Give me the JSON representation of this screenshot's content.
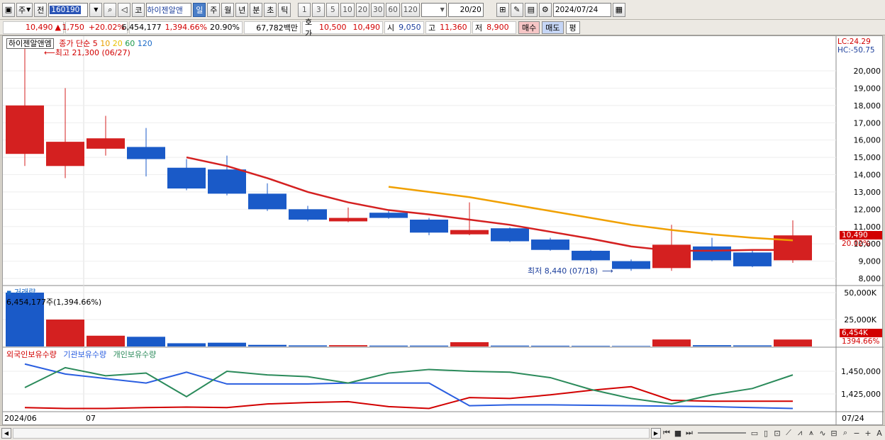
{
  "toolbar": {
    "market": "주",
    "prev_label": "전",
    "code": "160190",
    "market_short": "코",
    "name": "하이젠알앤",
    "periods": [
      "일",
      "주",
      "월",
      "년",
      "분",
      "초",
      "틱"
    ],
    "selected_period": "일",
    "intervals": [
      "1",
      "3",
      "5",
      "10",
      "20",
      "30",
      "60",
      "120"
    ],
    "count": "20/20",
    "date": "2024/07/24"
  },
  "quote": {
    "price": "10,490",
    "change": "1,750",
    "change_pct": "+20.02%",
    "volume": "6,454,177",
    "volume_ratio": "1,394.66%",
    "turnover": "20.90%",
    "value": "67,782백만",
    "ask_label": "호가",
    "ask": "10,500",
    "bid": "10,490",
    "open_label": "시",
    "open": "9,050",
    "high_label": "고",
    "high": "11,360",
    "low_label": "저",
    "low": "8,900",
    "buy_label": "매수",
    "sell_label": "매도",
    "avg_label": "평"
  },
  "price_panel": {
    "stock_label": "하이젠알앤엠",
    "legend_title": "종가 단순",
    "ma_labels": [
      "5",
      "10",
      "20",
      "60",
      "120"
    ],
    "ma_colors": [
      "#d20000",
      "#e8a000",
      "#e8c000",
      "#1a9a4a",
      "#1a6ac8"
    ],
    "max_annotation": "최고 21,300 (06/27)",
    "min_annotation": "최저 8,440 (07/18)",
    "lc": "LC:24.29",
    "hc": "HC:-50.75",
    "price_tag": "10,490",
    "pct_tag": "20.02%"
  },
  "volume_panel": {
    "title": "거래량",
    "readout": "6,454,177주(1,394.66%)",
    "tag": "6,454K",
    "pct_tag": "1394.66%"
  },
  "holding_panel": {
    "series_labels": [
      "외국인보유수량",
      "기관보유수량",
      "개인보유수량"
    ],
    "series_colors": [
      "#d20000",
      "#2a5ee0",
      "#2a8a5a"
    ]
  },
  "x_labels": {
    "start": "2024/06",
    "month": "07",
    "end": "07/24"
  },
  "chart_data": [
    {
      "type": "candlestick",
      "title": "",
      "y_ticks": [
        8000,
        9000,
        10000,
        11000,
        12000,
        13000,
        14000,
        15000,
        16000,
        17000,
        18000,
        19000,
        20000
      ],
      "candles": [
        {
          "open": 15200,
          "high": 21300,
          "low": 14500,
          "close": 18000
        },
        {
          "open": 14500,
          "high": 19000,
          "low": 13800,
          "close": 15900
        },
        {
          "open": 15500,
          "high": 17400,
          "low": 15100,
          "close": 16100
        },
        {
          "open": 15600,
          "high": 16700,
          "low": 13900,
          "close": 14900
        },
        {
          "open": 14400,
          "high": 14900,
          "low": 13100,
          "close": 13200
        },
        {
          "open": 14300,
          "high": 15100,
          "low": 12800,
          "close": 12900
        },
        {
          "open": 12900,
          "high": 13500,
          "low": 11900,
          "close": 12000
        },
        {
          "open": 12000,
          "high": 12200,
          "low": 11300,
          "close": 11400
        },
        {
          "open": 11300,
          "high": 12100,
          "low": 11250,
          "close": 11500
        },
        {
          "open": 11800,
          "high": 11900,
          "low": 11450,
          "close": 11500
        },
        {
          "open": 11400,
          "high": 11500,
          "low": 10500,
          "close": 10650
        },
        {
          "open": 10550,
          "high": 12400,
          "low": 10500,
          "close": 10800
        },
        {
          "open": 10900,
          "high": 10950,
          "low": 10100,
          "close": 10150
        },
        {
          "open": 10250,
          "high": 10350,
          "low": 9600,
          "close": 9650
        },
        {
          "open": 9600,
          "high": 9650,
          "low": 9000,
          "close": 9050
        },
        {
          "open": 9000,
          "high": 9100,
          "low": 8440,
          "close": 8550
        },
        {
          "open": 8600,
          "high": 11100,
          "low": 8440,
          "close": 9950
        },
        {
          "open": 9850,
          "high": 10350,
          "low": 9000,
          "close": 9050
        },
        {
          "open": 9500,
          "high": 9650,
          "low": 8650,
          "close": 8700
        },
        {
          "open": 9050,
          "high": 11360,
          "low": 8900,
          "close": 10490
        }
      ],
      "ma5": [
        null,
        null,
        null,
        null,
        15000,
        14500,
        13800,
        13000,
        12400,
        11950,
        11700,
        11400,
        11100,
        10700,
        10300,
        9850,
        9600,
        9600,
        9650,
        9650
      ],
      "ma10": [
        null,
        null,
        null,
        null,
        null,
        null,
        null,
        null,
        null,
        13300,
        13000,
        12700,
        12300,
        11900,
        11500,
        11100,
        10800,
        10550,
        10350,
        10200
      ]
    },
    {
      "type": "bar",
      "title": "거래량",
      "y_ticks": [
        "25,000K",
        "50,000K"
      ],
      "values": [
        50000,
        25000,
        10000,
        9000,
        3000,
        3500,
        1500,
        1000,
        1200,
        800,
        800,
        4000,
        800,
        700,
        600,
        500,
        6500,
        1200,
        1000,
        6454
      ],
      "colors": [
        "blue",
        "red",
        "red",
        "blue",
        "blue",
        "blue",
        "blue",
        "blue",
        "red",
        "blue",
        "blue",
        "red",
        "blue",
        "blue",
        "blue",
        "blue",
        "red",
        "blue",
        "blue",
        "red"
      ]
    },
    {
      "type": "line",
      "y_ticks": [
        "1,425,000",
        "1,450,000"
      ],
      "series": [
        {
          "name": "외국인보유수량",
          "values": [
            1410000,
            1409000,
            1409000,
            1410000,
            1410500,
            1410000,
            1414000,
            1415500,
            1416500,
            1411000,
            1409000,
            1421000,
            1420000,
            1424000,
            1429000,
            1433000,
            1418000,
            1417000,
            1417000,
            1417000
          ]
        },
        {
          "name": "기관보유수량",
          "values": [
            1458000,
            1447000,
            1442000,
            1437000,
            1449000,
            1436000,
            1436000,
            1436000,
            1437000,
            1437000,
            1437000,
            1412000,
            1413000,
            1413000,
            1412500,
            1412000,
            1411500,
            1411000,
            1410000,
            1409000
          ]
        },
        {
          "name": "개인보유수량",
          "values": [
            1432000,
            1454000,
            1445000,
            1448000,
            1422000,
            1450000,
            1446000,
            1444000,
            1437000,
            1448000,
            1452000,
            1450000,
            1449000,
            1443000,
            1430000,
            1420000,
            1414000,
            1424000,
            1431000,
            1446000
          ]
        }
      ]
    }
  ]
}
